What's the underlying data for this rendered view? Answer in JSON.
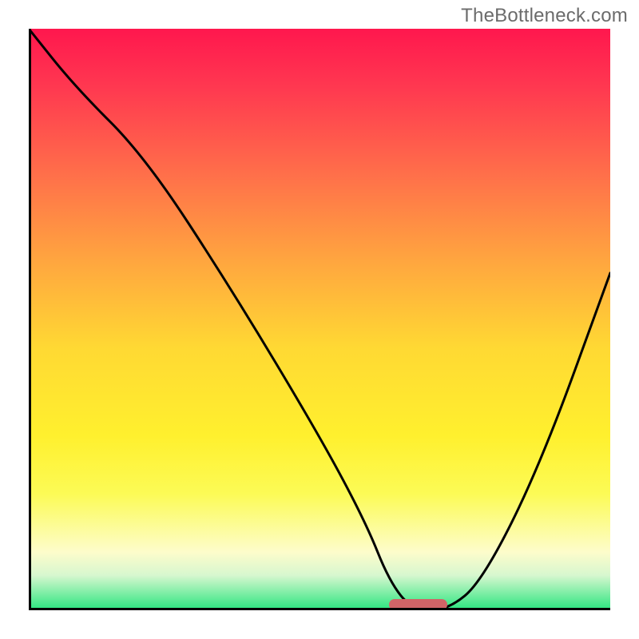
{
  "watermark": "TheBottleneck.com",
  "chart_data": {
    "type": "line",
    "title": "",
    "xlabel": "",
    "ylabel": "",
    "xlim": [
      0,
      100
    ],
    "ylim": [
      0,
      100
    ],
    "grid": false,
    "legend": false,
    "series": [
      {
        "name": "bottleneck-curve",
        "x": [
          0,
          8,
          20,
          35,
          50,
          58,
          62,
          66,
          72,
          78,
          88,
          100
        ],
        "values": [
          100,
          90,
          78,
          55,
          30,
          15,
          5,
          0,
          0,
          5,
          25,
          58
        ]
      }
    ],
    "marker": {
      "x_start": 62,
      "x_end": 72,
      "y": 0,
      "color": "#d16467"
    },
    "background_gradient": {
      "stops": [
        {
          "pos": 0,
          "color": "#ff174e"
        },
        {
          "pos": 10,
          "color": "#ff3850"
        },
        {
          "pos": 25,
          "color": "#ff6f4a"
        },
        {
          "pos": 40,
          "color": "#ffa63f"
        },
        {
          "pos": 55,
          "color": "#ffd933"
        },
        {
          "pos": 70,
          "color": "#fff02e"
        },
        {
          "pos": 80,
          "color": "#fcfb56"
        },
        {
          "pos": 90,
          "color": "#fdfccb"
        },
        {
          "pos": 94,
          "color": "#d7f7cf"
        },
        {
          "pos": 100,
          "color": "#28e57e"
        }
      ]
    }
  }
}
